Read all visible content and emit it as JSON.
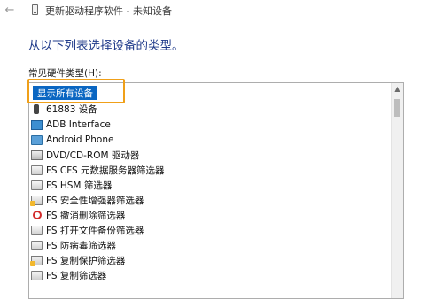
{
  "window": {
    "back_icon": "back-arrow-icon",
    "title": "更新驱动程序软件 - 未知设备"
  },
  "main": {
    "heading": "从以下列表选择设备的类型。",
    "list_label": "常见硬件类型(H):"
  },
  "hardware_types": [
    {
      "label": "显示所有设备",
      "icon": "none",
      "selected": true
    },
    {
      "label": "61883 设备",
      "icon": "usb-icon"
    },
    {
      "label": "ADB Interface",
      "icon": "monitor-icon"
    },
    {
      "label": "Android Phone",
      "icon": "phone-icon"
    },
    {
      "label": "DVD/CD-ROM 驱动器",
      "icon": "dvd-drive-icon"
    },
    {
      "label": "FS CFS 元数据服务器筛选器",
      "icon": "drive-icon"
    },
    {
      "label": "FS HSM 筛选器",
      "icon": "drive-icon"
    },
    {
      "label": "FS 安全性增强器筛选器",
      "icon": "drive-warning-icon"
    },
    {
      "label": "FS 撤消删除筛选器",
      "icon": "undelete-icon"
    },
    {
      "label": "FS 打开文件备份筛选器",
      "icon": "drive-icon"
    },
    {
      "label": "FS 防病毒筛选器",
      "icon": "drive-icon"
    },
    {
      "label": "FS 复制保护筛选器",
      "icon": "drive-warning-icon"
    },
    {
      "label": "FS 复制筛选器",
      "icon": "drive-icon"
    }
  ],
  "colors": {
    "selection": "#0a66c2",
    "highlight_border": "#f0a019",
    "heading": "#1f3a8a"
  }
}
